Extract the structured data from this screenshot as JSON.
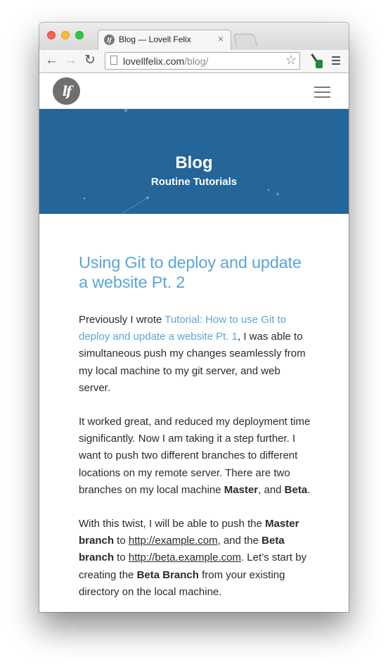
{
  "browser": {
    "tab_title": "Blog — Lovell Felix",
    "tab_favicon_text": "lf",
    "tab_close": "×",
    "url_host": "lovellfelix.com",
    "url_path": "/blog/",
    "icons": {
      "back": "arrow-left",
      "forward": "arrow-right",
      "reload": "reload",
      "star": "star",
      "menu": "hamburger",
      "extension": "eyedropper"
    }
  },
  "site": {
    "logo_text": "lf",
    "hero_title": "Blog",
    "hero_subtitle": "Routine Tutorials",
    "colors": {
      "hero_bg": "#24659a",
      "link": "#5aa5db",
      "text": "#2a2a2a"
    }
  },
  "post": {
    "title": "Using Git to deploy and update a website Pt. 2",
    "p1": {
      "pre": "Previously I wrote ",
      "link": "Tutorial: How to use Git to deploy and update a website Pt. 1",
      "post": ", I was able to simultaneous push my changes seamlessly from my local machine to my git server, and web server."
    },
    "p2": {
      "text": "It worked great, and reduced my deployment time significantly. Now I am taking it a step further. I want to push two different branches to different locations on my remote server. There are two branches on my local machine ",
      "master": "Master",
      "and": ", and ",
      "beta": "Beta",
      "end": "."
    },
    "p3": {
      "t1": "With this twist, I will be able to push the ",
      "b1": "Master branch",
      "t2": " to ",
      "l1": "http://example.com",
      "t3": ", and the ",
      "b2": "Beta branch",
      "t4": " to ",
      "l2": "http://beta.example.com",
      "t5": ". Let’s start by creating the ",
      "b3": "Beta Branch",
      "t6": " from your existing directory on the local machine."
    }
  }
}
